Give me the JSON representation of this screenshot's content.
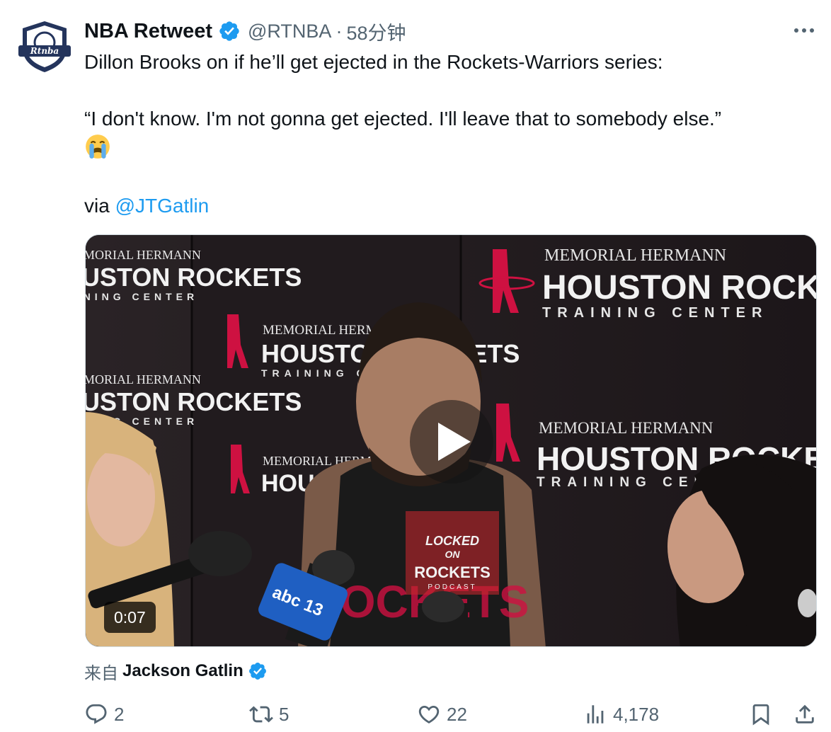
{
  "tweet": {
    "author_name": "NBA Retweet",
    "handle": "@RTNBA",
    "separator": "·",
    "time": "58分钟",
    "line1": "Dillon Brooks on if he’ll get ejected in the Rockets-Warriors series:",
    "quote": "“I don't know. I'm not gonna get ejected. I'll leave that to somebody else.”",
    "emoji": "loudly-crying-face",
    "via_label": "via",
    "via_link": "@JTGatlin"
  },
  "avatar": {
    "text": "Rtnba"
  },
  "media": {
    "duration": "0:07",
    "backdrop": {
      "sponsor": "MEMORIAL HERMANN",
      "team": "HOUSTON ROCKETS",
      "facility": "TRAINING CENTER"
    },
    "overlay_logo": {
      "line1": "LOCKED",
      "line2": "ON",
      "line3": "ROCKETS",
      "line4": "PODCAST"
    },
    "mic_logo": "abc 13"
  },
  "source": {
    "prefix": "来自",
    "author": "Jackson Gatlin"
  },
  "actions": {
    "reply_count": "2",
    "retweet_count": "5",
    "like_count": "22",
    "view_count": "4,178"
  },
  "colors": {
    "accent": "#1d9bf0",
    "text": "#0f1419",
    "muted": "#536471",
    "rockets_red": "#ce1141"
  }
}
